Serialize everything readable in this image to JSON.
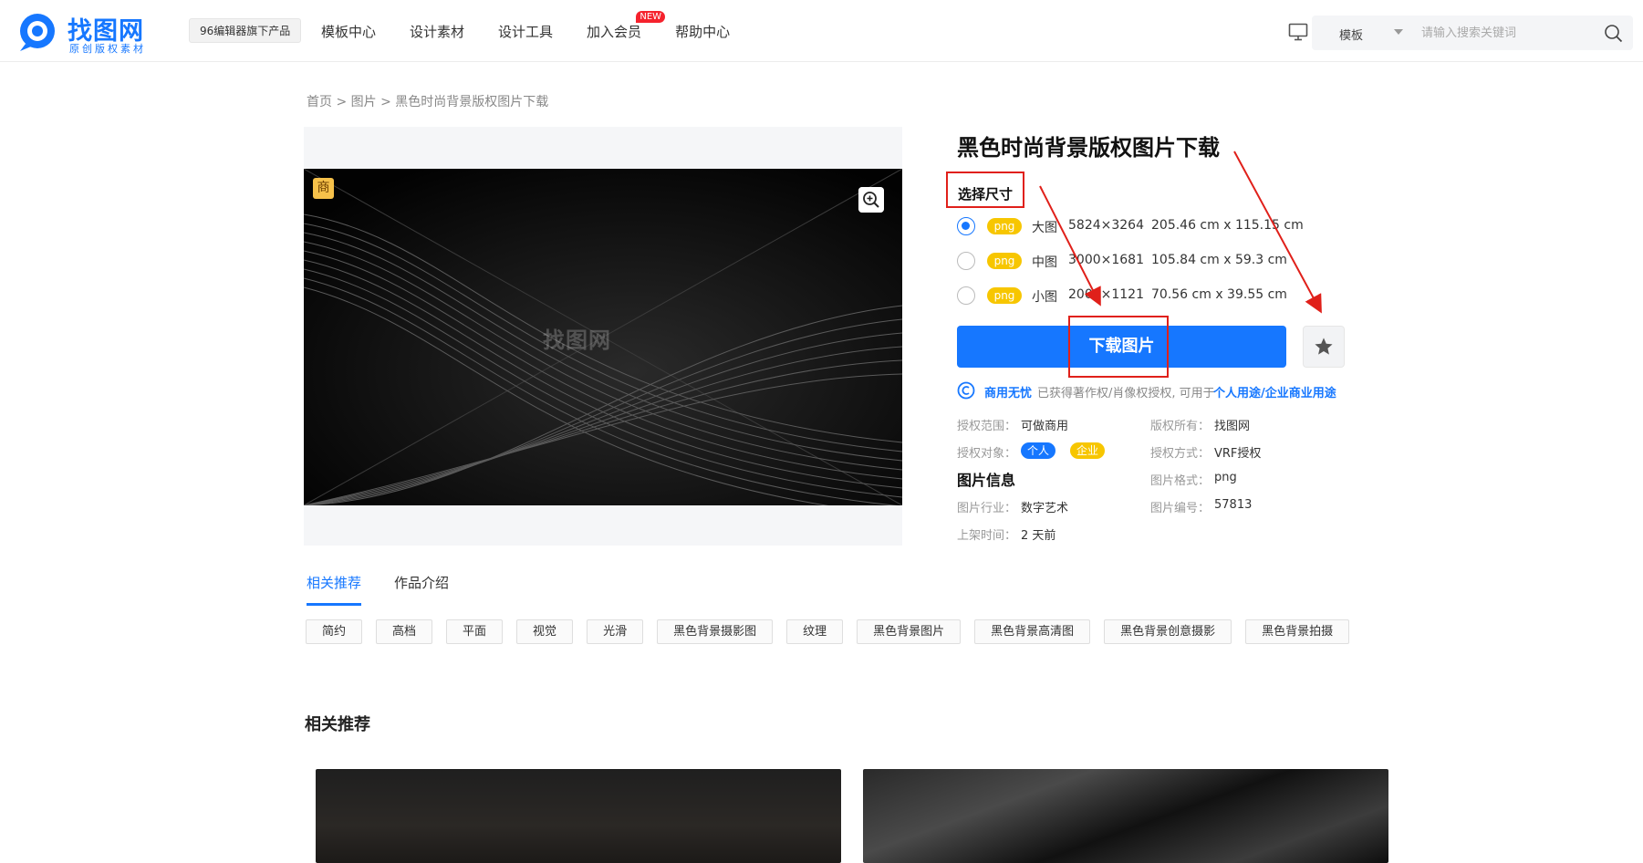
{
  "header": {
    "logo_title": "找图网",
    "logo_sub": "原创版权素材",
    "product_badge": "96编辑器旗下产品",
    "nav": [
      "模板中心",
      "设计素材",
      "设计工具",
      "加入会员",
      "帮助中心"
    ],
    "new_badge": "NEW",
    "search_type": "模板",
    "search_placeholder": "请输入搜索关键词"
  },
  "breadcrumb": {
    "home": "首页",
    "sep": " > ",
    "category": "图片",
    "current": "黑色时尚背景版权图片下载"
  },
  "preview": {
    "commercial_badge": "商",
    "watermark": "找图网"
  },
  "detail": {
    "title": "黑色时尚背景版权图片下载",
    "size_label": "选择尺寸",
    "sizes": [
      {
        "format": "png",
        "name": "大图",
        "pixels": "5824×3264",
        "cm": "205.46 cm x 115.15 cm",
        "selected": true
      },
      {
        "format": "png",
        "name": "中图",
        "pixels": "3000×1681",
        "cm": "105.84 cm x 59.3 cm",
        "selected": false
      },
      {
        "format": "png",
        "name": "小图",
        "pixels": "2000×1121",
        "cm": "70.56 cm x 39.55 cm",
        "selected": false
      }
    ],
    "download_label": "下载图片",
    "license_strong": "商用无忧",
    "license_desc": "已获得著作权/肖像权授权, 可用于",
    "license_link": "个人用途/企业商业用途",
    "info": {
      "scope_label": "授权范围：",
      "scope_value": "可做商用",
      "owner_label": "版权所有：",
      "owner_value": "找图网",
      "target_label": "授权对象：",
      "target_personal": "个人",
      "target_company": "企业",
      "method_label": "授权方式：",
      "method_value": "VRF授权",
      "heading": "图片信息",
      "format_label": "图片格式：",
      "format_value": "png",
      "industry_label": "图片行业：",
      "industry_value": "数字艺术",
      "id_label": "图片编号：",
      "id_value": "57813",
      "time_label": "上架时间：",
      "time_value": "2 天前"
    }
  },
  "tabs": [
    "相关推荐",
    "作品介绍"
  ],
  "keywords": [
    "简约",
    "高档",
    "平面",
    "视觉",
    "光滑",
    "黑色背景摄影图",
    "纹理",
    "黑色背景图片",
    "黑色背景高清图",
    "黑色背景创意摄影",
    "黑色背景拍摄"
  ],
  "related_heading": "相关推荐",
  "colors": {
    "brand": "#1677ff",
    "pill_yellow": "#f7c600",
    "annotation_red": "#e0201a",
    "new_badge": "#f5222d"
  },
  "icons": [
    "logo-mark-icon",
    "monitor-icon",
    "search-icon",
    "zoom-in-icon",
    "star-icon",
    "copyright-icon"
  ]
}
